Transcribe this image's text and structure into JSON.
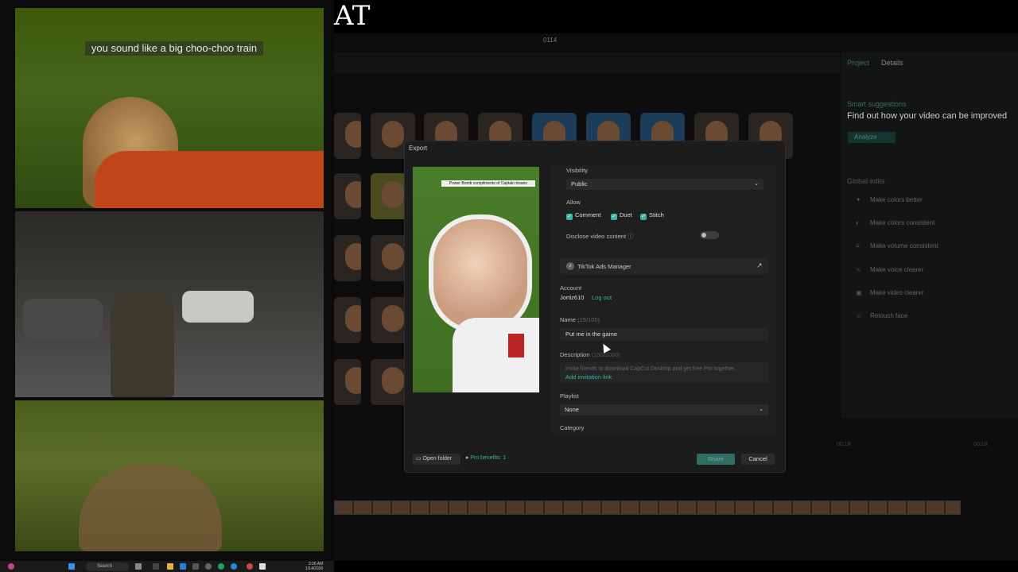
{
  "stream": {
    "caption": "you sound like a big choo-choo train",
    "overlay_title": "AT"
  },
  "app": {
    "title": "0114",
    "tabs": [
      "Project",
      "Details"
    ],
    "smart_suggestions": "Smart suggestions",
    "find_out": "Find out how your video can be improved",
    "analyze": "Analyze",
    "global_edits": "Global edits",
    "global_items": [
      "Make colors better",
      "Make colors consistent",
      "Make volume consistent",
      "Make voice clearer",
      "Make video clearer",
      "Retouch face"
    ],
    "timeline_ticks": [
      "00:16",
      "00:18"
    ]
  },
  "export": {
    "title": "Export",
    "preview_caption": "Power Bomb compliments of Captain insano",
    "visibility_label": "Visibility",
    "visibility_value": "Public",
    "allow_label": "Allow",
    "allow_options": [
      "Comment",
      "Duet",
      "Stitch"
    ],
    "disclose_label": "Disclose video content",
    "ads_manager": "TikTok Ads Manager",
    "account_label": "Account",
    "account_name": "Jortiz610",
    "logout": "Log out",
    "name_label": "Name",
    "name_count": "(19/100)",
    "name_value": "Put me in the game",
    "description_label": "Description",
    "description_count": "(150/2000)",
    "description_placeholder": "Invite friends to download CapCut Desktop and get free Pro together.",
    "invitation_link": "Add invitation link",
    "playlist_label": "Playlist",
    "playlist_value": "None",
    "category_label": "Category",
    "open_folder": "Open folder",
    "pro_benefits": "Pro benefits: 1",
    "share": "Share",
    "cancel": "Cancel"
  },
  "taskbar": {
    "search": "Search",
    "time": "3:26 AM",
    "date": "1/14/2026"
  }
}
